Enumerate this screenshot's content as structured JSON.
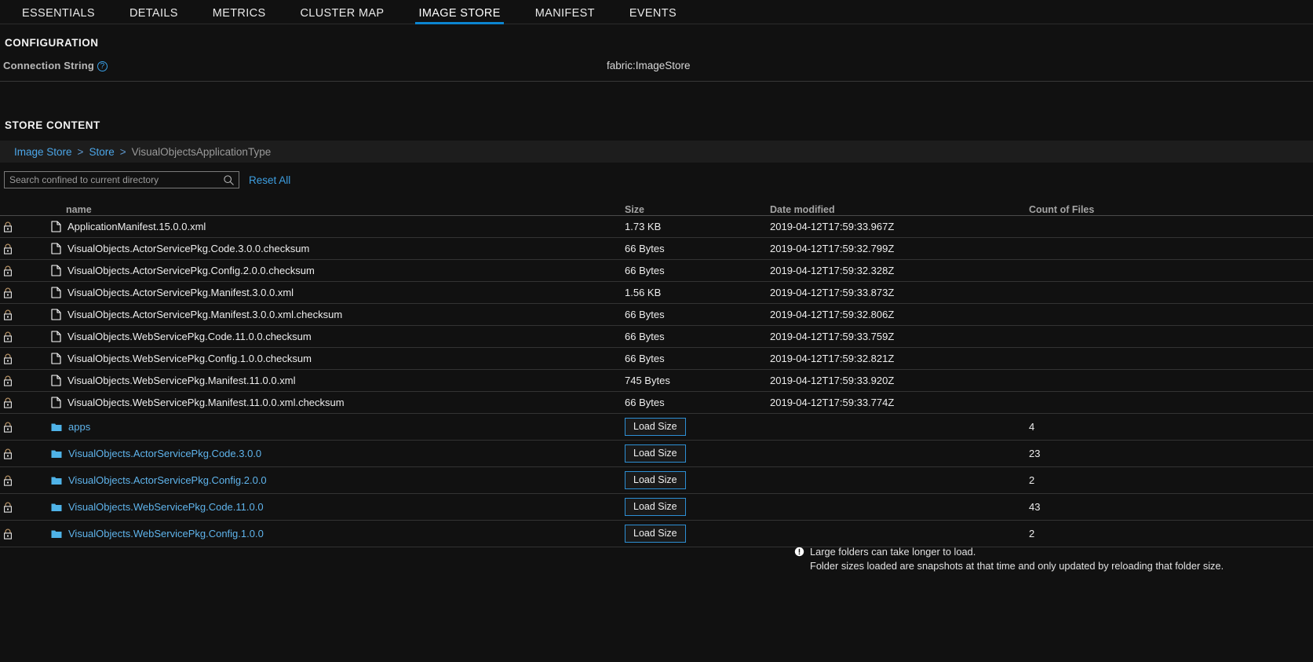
{
  "tabs": [
    {
      "label": "ESSENTIALS",
      "active": false
    },
    {
      "label": "DETAILS",
      "active": false
    },
    {
      "label": "METRICS",
      "active": false
    },
    {
      "label": "CLUSTER MAP",
      "active": false
    },
    {
      "label": "IMAGE STORE",
      "active": true
    },
    {
      "label": "MANIFEST",
      "active": false
    },
    {
      "label": "EVENTS",
      "active": false
    }
  ],
  "configuration": {
    "heading": "CONFIGURATION",
    "connection_string_label": "Connection String",
    "help_icon": "help-circle-icon",
    "help_glyph": "?",
    "connection_string_value": "fabric:ImageStore"
  },
  "store_content": {
    "heading": "STORE CONTENT",
    "breadcrumb": {
      "items": [
        "Image Store",
        "Store",
        "VisualObjectsApplicationType"
      ],
      "separator": ">",
      "current_index": 2
    },
    "search": {
      "placeholder": "Search confined to current directory",
      "value": "",
      "icon": "search-icon",
      "reset_label": "Reset All"
    },
    "columns": [
      "name",
      "Size",
      "Date modified",
      "Count of Files"
    ],
    "rows": [
      {
        "type": "file",
        "icon": "file-icon",
        "lock": "lock-icon",
        "name": "ApplicationManifest.15.0.0.xml",
        "size": "1.73 KB",
        "date": "2019-04-12T17:59:33.967Z",
        "count": ""
      },
      {
        "type": "file",
        "icon": "file-icon",
        "lock": "lock-icon",
        "name": "VisualObjects.ActorServicePkg.Code.3.0.0.checksum",
        "size": "66 Bytes",
        "date": "2019-04-12T17:59:32.799Z",
        "count": ""
      },
      {
        "type": "file",
        "icon": "file-icon",
        "lock": "lock-icon",
        "name": "VisualObjects.ActorServicePkg.Config.2.0.0.checksum",
        "size": "66 Bytes",
        "date": "2019-04-12T17:59:32.328Z",
        "count": ""
      },
      {
        "type": "file",
        "icon": "file-icon",
        "lock": "lock-icon",
        "name": "VisualObjects.ActorServicePkg.Manifest.3.0.0.xml",
        "size": "1.56 KB",
        "date": "2019-04-12T17:59:33.873Z",
        "count": ""
      },
      {
        "type": "file",
        "icon": "file-icon",
        "lock": "lock-icon",
        "name": "VisualObjects.ActorServicePkg.Manifest.3.0.0.xml.checksum",
        "size": "66 Bytes",
        "date": "2019-04-12T17:59:32.806Z",
        "count": ""
      },
      {
        "type": "file",
        "icon": "file-icon",
        "lock": "lock-icon",
        "name": "VisualObjects.WebServicePkg.Code.11.0.0.checksum",
        "size": "66 Bytes",
        "date": "2019-04-12T17:59:33.759Z",
        "count": ""
      },
      {
        "type": "file",
        "icon": "file-icon",
        "lock": "lock-icon",
        "name": "VisualObjects.WebServicePkg.Config.1.0.0.checksum",
        "size": "66 Bytes",
        "date": "2019-04-12T17:59:32.821Z",
        "count": ""
      },
      {
        "type": "file",
        "icon": "file-icon",
        "lock": "lock-icon",
        "name": "VisualObjects.WebServicePkg.Manifest.11.0.0.xml",
        "size": "745 Bytes",
        "date": "2019-04-12T17:59:33.920Z",
        "count": ""
      },
      {
        "type": "file",
        "icon": "file-icon",
        "lock": "lock-icon",
        "name": "VisualObjects.WebServicePkg.Manifest.11.0.0.xml.checksum",
        "size": "66 Bytes",
        "date": "2019-04-12T17:59:33.774Z",
        "count": ""
      },
      {
        "type": "folder",
        "icon": "folder-icon",
        "lock": "lock-icon",
        "name": "apps",
        "size_button": "Load Size",
        "date": "",
        "count": "4"
      },
      {
        "type": "folder",
        "icon": "folder-icon",
        "lock": "lock-icon",
        "name": "VisualObjects.ActorServicePkg.Code.3.0.0",
        "size_button": "Load Size",
        "date": "",
        "count": "23"
      },
      {
        "type": "folder",
        "icon": "folder-icon",
        "lock": "lock-icon",
        "name": "VisualObjects.ActorServicePkg.Config.2.0.0",
        "size_button": "Load Size",
        "date": "",
        "count": "2"
      },
      {
        "type": "folder",
        "icon": "folder-icon",
        "lock": "lock-icon",
        "name": "VisualObjects.WebServicePkg.Code.11.0.0",
        "size_button": "Load Size",
        "date": "",
        "count": "43"
      },
      {
        "type": "folder",
        "icon": "folder-icon",
        "lock": "lock-icon",
        "name": "VisualObjects.WebServicePkg.Config.1.0.0",
        "size_button": "Load Size",
        "date": "",
        "count": "2"
      }
    ],
    "footnote": {
      "icon": "info-alert-icon",
      "line1": "Large folders can take longer to load.",
      "line2": "Folder sizes loaded are snapshots at that time and only updated by reloading that folder size."
    }
  },
  "colors": {
    "background": "#111111",
    "accent_blue": "#0c85d0",
    "link_blue": "#5fb4ec",
    "row_border": "#333333",
    "text": "#ededed"
  }
}
